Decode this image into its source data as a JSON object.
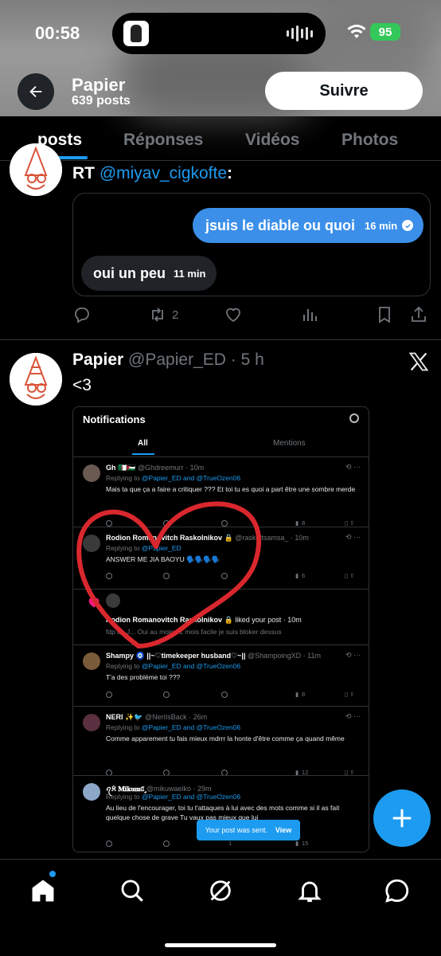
{
  "status_bar": {
    "time": "00:58",
    "battery": "95"
  },
  "header": {
    "name": "Papier",
    "posts_count": "639 posts",
    "follow_label": "Suivre"
  },
  "tabs": [
    {
      "label": "posts",
      "active": true
    },
    {
      "label": "Réponses",
      "active": false
    },
    {
      "label": "Vidéos",
      "active": false
    },
    {
      "label": "Photos",
      "active": false
    }
  ],
  "post1": {
    "rt_prefix": "RT ",
    "rt_handle": "@miyav_cigkofte",
    "rt_suffix": ":",
    "messages": [
      {
        "text": "jsuis le diable ou quoi",
        "time": "16 min",
        "side": "right"
      },
      {
        "text": "oui un peu",
        "time": "11 min",
        "side": "left"
      }
    ],
    "actions": {
      "retweets": "2"
    }
  },
  "post2": {
    "name": "Papier",
    "handle": "@Papier_ED",
    "sep": " · ",
    "time": "5 h",
    "text": "<3",
    "screenshot": {
      "title": "Notifications",
      "tab_all": "All",
      "tab_mentions": "Mentions",
      "items": [
        {
          "name": "Gh 🇩🇿🇵🇸",
          "handle": "@Ghdreemurr · 10m",
          "reply": "Replying to ",
          "reply_to": "@Papier_ED and @TrueOzen06",
          "text": "Mais ta que ça a faire a critiquer ??? Et toi tu es quoi a part être une sombre merde",
          "views": "8"
        },
        {
          "name": "Rodion Romanovitch Raskolnikov 🔒",
          "handle": "@raskoltsamsa_ · 10m",
          "reply": "Replying to ",
          "reply_to": "@Papier_ED",
          "text": "ANSWER ME JIA BAOYU 🗣️🗣️🗣️🗣️",
          "views": "6"
        },
        {
          "name": "Rodion Romanovitch Raskolnikov 🔒",
          "handle": "liked your post · 10m",
          "reply": "",
          "reply_to": "",
          "text": "fdp de J... Oui au moins 1 mois facile je suis bloker dessus",
          "views": ""
        },
        {
          "name": "Shampy 🧿 ||~♡timekeeper husband♡~||",
          "handle": "@ShampoingXD · 11m",
          "reply": "Replying to ",
          "reply_to": "@Papier_ED and @TrueOzen06",
          "text": "T'a des probléme toi ???",
          "views": "8"
        },
        {
          "name": "NERI ✨🐦",
          "handle": "@NeriIsBack · 26m",
          "reply": "Replying to ",
          "reply_to": "@Papier_ED and @TrueOzen06",
          "text": "Comme apparement tu fais mieux mdrrr la honte d'être comme ça quand même",
          "views": "12"
        },
        {
          "name": "ꪖ𝔎 𝐌𝐢𝐤𝐮𝐦ᥲٍٍٍ̄",
          "handle": "@mikuwaeiko · 29m",
          "reply": "Replying to ",
          "reply_to": "@Papier_ED and @TrueOzen06",
          "text": "Au lieu de l'encourager, toi tu t'attaques à lui avec des mots comme si il as fait quelque chose de grave Tu vaux pas mieux que lui",
          "views": "15",
          "likes": "1"
        }
      ],
      "toast_text": "Your post was sent.",
      "toast_action": "View"
    }
  },
  "colors": {
    "accent": "#1d9bf0",
    "background": "#000000",
    "bubble_blue": "#3b8fe9",
    "annotation_red": "#d9272e"
  },
  "icons": [
    "back-arrow-icon",
    "reply-icon",
    "retweet-icon",
    "like-icon",
    "views-icon",
    "bookmark-icon",
    "share-icon",
    "x-logo-icon",
    "plus-icon",
    "home-icon",
    "search-icon",
    "grok-icon",
    "bell-icon",
    "messages-icon"
  ]
}
